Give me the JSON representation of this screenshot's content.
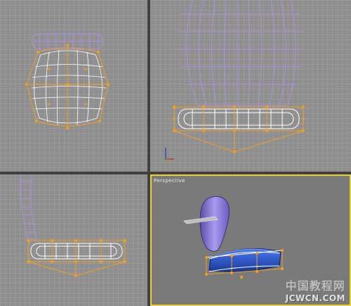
{
  "viewports": {
    "top": {
      "label": ""
    },
    "front": {
      "label": ""
    },
    "left": {
      "label": ""
    },
    "perspective": {
      "label": "Perspective",
      "active": true
    }
  },
  "colors": {
    "viewport_bg": "#8e8e8e",
    "grid": "#9a9a9a",
    "divider": "#404040",
    "active_border": "#e8d33a",
    "wire_purple": "#b08fe0",
    "wire_white": "#ffffff",
    "wire_orange": "#f0a020",
    "seat_blue": "#2a54c6",
    "backrest_purple": "#8c7ad6"
  },
  "icons": [
    "axis-tripod-icon"
  ],
  "watermark": {
    "chinese": "中国教程网",
    "url": "JCWCN.COM"
  }
}
